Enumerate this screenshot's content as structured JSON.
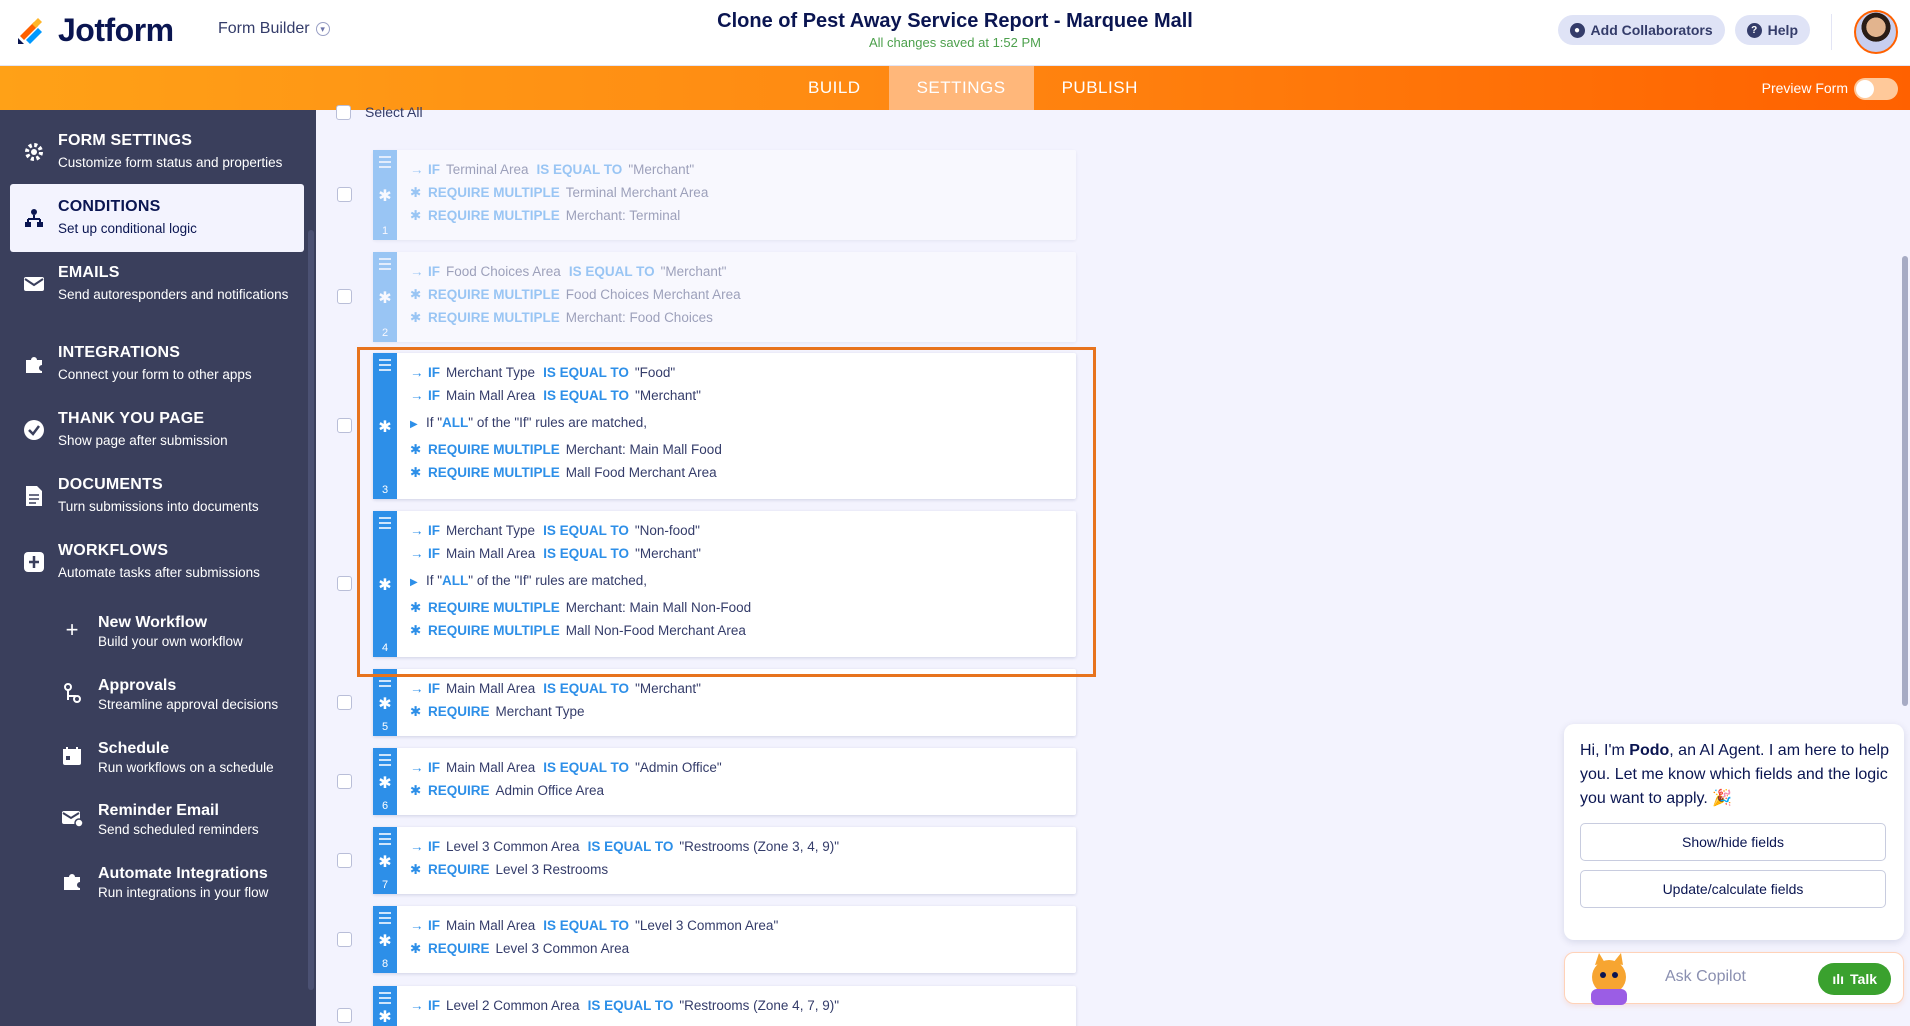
{
  "app": {
    "brand": "Jotform",
    "menu": "Form Builder"
  },
  "document": {
    "title": "Clone of Pest Away Service Report - Marquee Mall",
    "save_status": "All changes saved at 1:52 PM"
  },
  "header_actions": {
    "collaborators": "Add Collaborators",
    "help": "Help"
  },
  "nav": {
    "tabs": [
      "BUILD",
      "SETTINGS",
      "PUBLISH"
    ],
    "active_tab": "SETTINGS",
    "preview_label": "Preview Form",
    "preview_on": false
  },
  "sidebar": {
    "items": [
      {
        "title": "FORM SETTINGS",
        "subtitle": "Customize form status and properties",
        "icon": "gear-icon"
      },
      {
        "title": "CONDITIONS",
        "subtitle": "Set up conditional logic",
        "icon": "conditions-icon",
        "active": true
      },
      {
        "title": "EMAILS",
        "subtitle": "Send autoresponders and notifications",
        "icon": "envelope-icon"
      },
      {
        "title": "INTEGRATIONS",
        "subtitle": "Connect your form to other apps",
        "icon": "puzzle-icon"
      },
      {
        "title": "THANK YOU PAGE",
        "subtitle": "Show page after submission",
        "icon": "check-circle-icon"
      },
      {
        "title": "DOCUMENTS",
        "subtitle": "Turn submissions into documents",
        "icon": "document-icon"
      },
      {
        "title": "WORKFLOWS",
        "subtitle": "Automate tasks after submissions",
        "icon": "workflow-icon"
      }
    ],
    "workflow_items": [
      {
        "title": "New Workflow",
        "subtitle": "Build your own workflow",
        "icon": "plus-icon"
      },
      {
        "title": "Approvals",
        "subtitle": "Streamline approval decisions",
        "icon": "approval-icon"
      },
      {
        "title": "Schedule",
        "subtitle": "Run workflows on a schedule",
        "icon": "calendar-icon"
      },
      {
        "title": "Reminder Email",
        "subtitle": "Send scheduled reminders",
        "icon": "reminder-email-icon"
      },
      {
        "title": "Automate Integrations",
        "subtitle": "Run integrations in your flow",
        "icon": "puzzle-icon"
      }
    ]
  },
  "conditions": {
    "select_all": "Select All",
    "kw": {
      "if": "IF",
      "equal": "IS EQUAL TO",
      "require_multiple": "REQUIRE MULTIPLE",
      "require": "REQUIRE",
      "all": "ALL"
    },
    "items": [
      {
        "num": "1",
        "faded": true,
        "lines": [
          {
            "type": "if",
            "field": "Terminal Area",
            "value": "\"Merchant\""
          },
          {
            "type": "do",
            "action": "REQUIRE MULTIPLE",
            "target": "Terminal Merchant Area"
          },
          {
            "type": "do",
            "action": "REQUIRE MULTIPLE",
            "target": "Merchant: Terminal"
          }
        ]
      },
      {
        "num": "2",
        "faded": true,
        "lines": [
          {
            "type": "if",
            "field": "Food Choices Area",
            "value": "\"Merchant\""
          },
          {
            "type": "do",
            "action": "REQUIRE MULTIPLE",
            "target": "Food Choices Merchant Area"
          },
          {
            "type": "do",
            "action": "REQUIRE MULTIPLE",
            "target": "Merchant: Food Choices"
          }
        ]
      },
      {
        "num": "3",
        "lines": [
          {
            "type": "if",
            "field": "Merchant Type",
            "value": "\"Food\""
          },
          {
            "type": "if",
            "field": "Main Mall Area",
            "value": "\"Merchant\""
          },
          {
            "type": "all",
            "pre": "If \"",
            "post": "\" of the \"If\" rules are matched,"
          },
          {
            "type": "do",
            "action": "REQUIRE MULTIPLE",
            "target": "Merchant: Main Mall Food"
          },
          {
            "type": "do",
            "action": "REQUIRE MULTIPLE",
            "target": "Mall Food Merchant Area"
          }
        ]
      },
      {
        "num": "4",
        "lines": [
          {
            "type": "if",
            "field": "Merchant Type",
            "value": "\"Non-food\""
          },
          {
            "type": "if",
            "field": "Main Mall Area",
            "value": "\"Merchant\""
          },
          {
            "type": "all",
            "pre": "If \"",
            "post": "\" of the \"If\" rules are matched,"
          },
          {
            "type": "do",
            "action": "REQUIRE MULTIPLE",
            "target": "Merchant: Main Mall Non-Food"
          },
          {
            "type": "do",
            "action": "REQUIRE MULTIPLE",
            "target": "Mall Non-Food Merchant Area"
          }
        ]
      },
      {
        "num": "5",
        "lines": [
          {
            "type": "if",
            "field": "Main Mall Area",
            "value": "\"Merchant\""
          },
          {
            "type": "do",
            "action": "REQUIRE",
            "target": "Merchant Type"
          }
        ]
      },
      {
        "num": "6",
        "lines": [
          {
            "type": "if",
            "field": "Main Mall Area",
            "value": "\"Admin Office\""
          },
          {
            "type": "do",
            "action": "REQUIRE",
            "target": "Admin Office Area"
          }
        ]
      },
      {
        "num": "7",
        "lines": [
          {
            "type": "if",
            "field": "Level 3 Common Area",
            "value": "\"Restrooms (Zone 3, 4, 9)\""
          },
          {
            "type": "do",
            "action": "REQUIRE",
            "target": "Level 3 Restrooms"
          }
        ]
      },
      {
        "num": "8",
        "lines": [
          {
            "type": "if",
            "field": "Main Mall Area",
            "value": "\"Level 3 Common Area\""
          },
          {
            "type": "do",
            "action": "REQUIRE",
            "target": "Level 3 Common Area"
          }
        ]
      },
      {
        "num": "9",
        "lines": [
          {
            "type": "if",
            "field": "Level 2 Common Area",
            "value": "\"Restrooms (Zone 4, 7, 9)\""
          }
        ]
      }
    ]
  },
  "copilot": {
    "greeting_pre": "Hi, I'm ",
    "agent_name": "Podo",
    "greeting_post": ", an AI Agent. I am here to help you. Let me know which fields and the logic you want to apply. 🎉",
    "suggestions": [
      "Show/hide fields",
      "Update/calculate fields"
    ],
    "input_placeholder": "Ask Copilot",
    "talk": "Talk"
  },
  "colors": {
    "accent": "#ff6100",
    "condition_blue": "#2d8fe8",
    "sidebar_bg": "#3a3f5c",
    "highlight": "#e7731d"
  }
}
